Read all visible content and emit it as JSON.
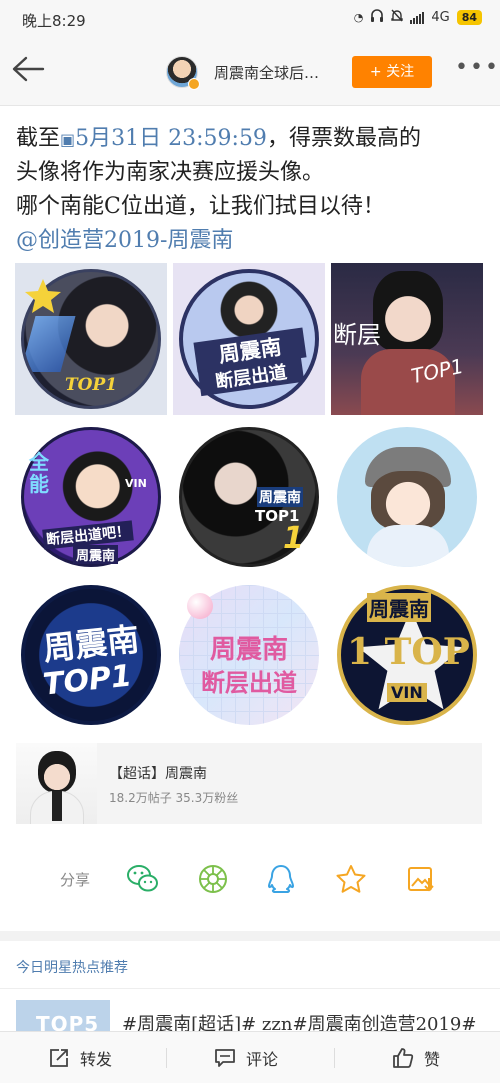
{
  "status_bar": {
    "time": "晚上8:29",
    "network": "4G",
    "battery": "84"
  },
  "header": {
    "title": "周震南全球后…",
    "follow_label": "+ 关注",
    "more_label": "•••"
  },
  "post": {
    "line1_prefix": "截至",
    "line1_date": "5月31日 23:59:59",
    "line1_suffix": "，得票数最高的",
    "line2": "头像将作为南家决赛应援头像。",
    "line3": "哪个南能C位出道，让我们拭目以待！",
    "line4": "@创造营2019-周震南"
  },
  "grid": {
    "img1": {
      "text": "TOP1"
    },
    "img2": {
      "text_a": "周震南",
      "text_b": "断层出道"
    },
    "img3": {
      "text_a": "断层",
      "text_b": "TOP1"
    },
    "img4": {
      "text_a": "全能",
      "text_b": "断层出道吧！",
      "text_c": "周震南",
      "text_d": "VIN"
    },
    "img5": {
      "text_a": "周震南",
      "text_b": "TOP1"
    },
    "img7": {
      "text_a": "周震南",
      "text_b": "TOP1"
    },
    "img8": {
      "text_a": "周震南",
      "text_b": "断层出道"
    },
    "img9": {
      "text_a": "周震南",
      "text_b": "1 TOP",
      "text_c": "VIN"
    }
  },
  "topic": {
    "title": "【超话】周震南",
    "stats": "18.2万帖子  35.3万粉丝"
  },
  "share": {
    "label": "分享"
  },
  "recommend": {
    "title": "今日明星热点推荐",
    "text": "#周震南[超话]# zzn#周震南创造营2019#",
    "thumb_text": "TOP5"
  },
  "bottom_bar": {
    "repost": "转发",
    "comment": "评论",
    "like": "赞"
  },
  "colors": {
    "accent": "#ff8200",
    "link": "#507daf"
  }
}
